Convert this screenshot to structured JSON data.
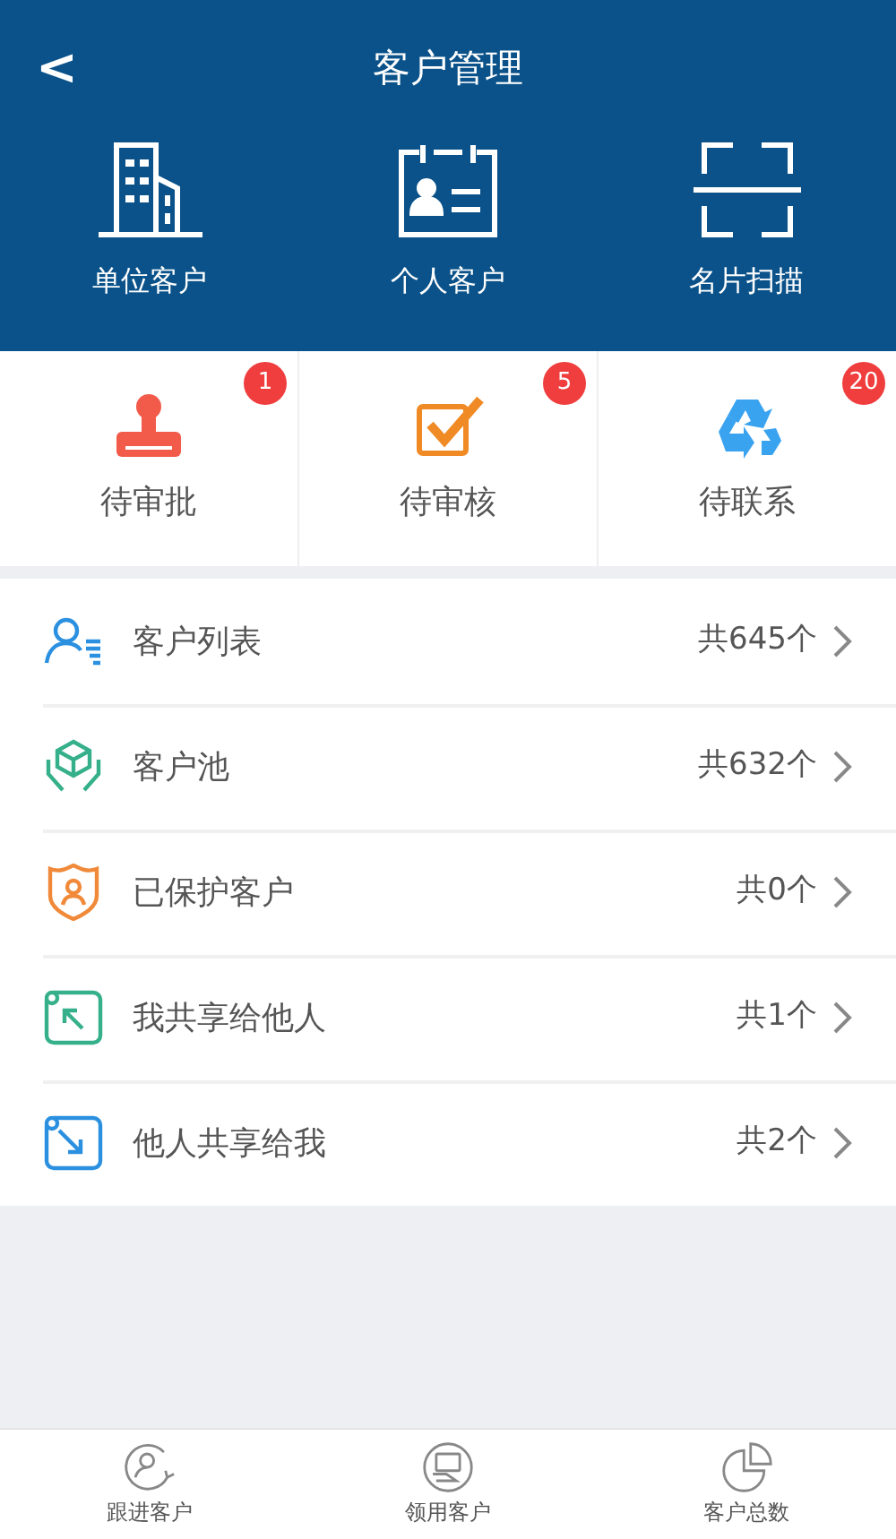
{
  "header": {
    "back": "<",
    "title": "客户管理"
  },
  "shortcuts": [
    {
      "label": "单位客户"
    },
    {
      "label": "个人客户"
    },
    {
      "label": "名片扫描"
    }
  ],
  "pending": [
    {
      "label": "待审批",
      "count": "1"
    },
    {
      "label": "待审核",
      "count": "5"
    },
    {
      "label": "待联系",
      "count": "20"
    }
  ],
  "list": [
    {
      "label": "客户列表",
      "count": "共645个"
    },
    {
      "label": "客户池",
      "count": "共632个"
    },
    {
      "label": "已保护客户",
      "count": "共0个"
    },
    {
      "label": "我共享给他人",
      "count": "共1个"
    },
    {
      "label": "他人共享给我",
      "count": "共2个"
    }
  ],
  "bottom_nav": [
    {
      "label": "跟进客户"
    },
    {
      "label": "领用客户"
    },
    {
      "label": "客户总数"
    }
  ]
}
